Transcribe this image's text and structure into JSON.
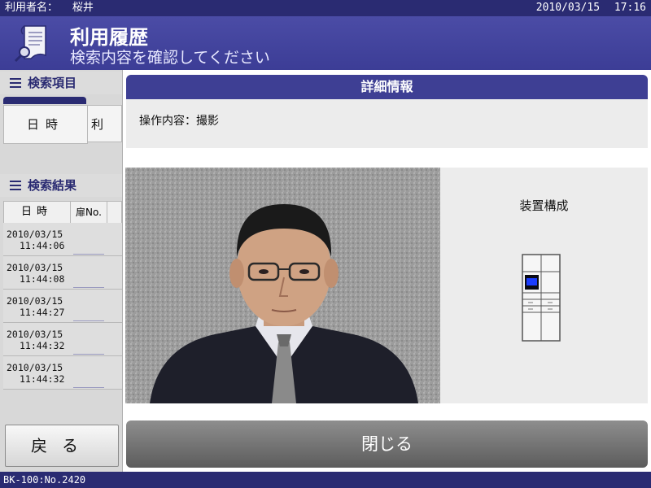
{
  "status_bar": {
    "user_label": "利用者名：",
    "user_name": "桜井",
    "date": "2010/03/15",
    "time": "17:16"
  },
  "header": {
    "title": "利用履歴",
    "subtitle": "検索内容を確認してください",
    "icon": "document-search-icon"
  },
  "search_items": {
    "heading": "検索項目",
    "tabs": [
      {
        "label": "日時"
      },
      {
        "label": "利"
      }
    ]
  },
  "search_results": {
    "heading": "検索結果",
    "columns": [
      "日時",
      "扉No."
    ],
    "rows": [
      {
        "date": "2010/03/15",
        "time": "11:44:06"
      },
      {
        "date": "2010/03/15",
        "time": "11:44:08"
      },
      {
        "date": "2010/03/15",
        "time": "11:44:27"
      },
      {
        "date": "2010/03/15",
        "time": "11:44:32"
      },
      {
        "date": "2010/03/15",
        "time": "11:44:32"
      }
    ]
  },
  "back_button": {
    "label": "戻る"
  },
  "detail": {
    "heading": "詳細情報",
    "operation": "操作内容：撮影",
    "device_title": "装置構成",
    "highlight_color": "#1a3cff"
  },
  "close_button": {
    "label": "閉じる"
  },
  "footer": {
    "text": "BK-100:No.2420"
  },
  "colors": {
    "navy": "#2a2b72",
    "header": "#4b4ca6",
    "panel": "#3e3f94"
  }
}
